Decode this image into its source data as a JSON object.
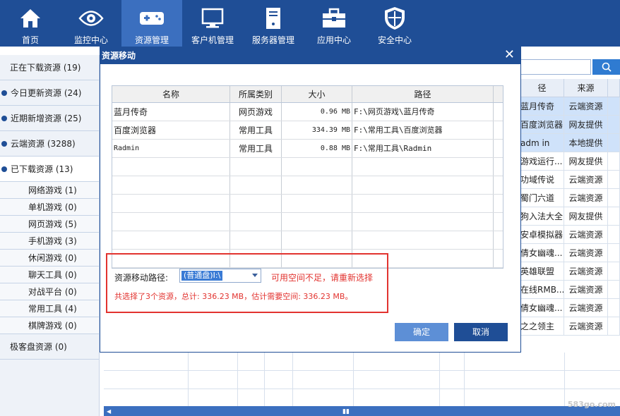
{
  "nav": {
    "items": [
      {
        "label": "首页",
        "icon": "home-icon"
      },
      {
        "label": "监控中心",
        "icon": "eye-icon"
      },
      {
        "label": "资源管理",
        "icon": "gamepad-icon"
      },
      {
        "label": "客户机管理",
        "icon": "monitor-icon"
      },
      {
        "label": "服务器管理",
        "icon": "server-icon"
      },
      {
        "label": "应用中心",
        "icon": "toolbox-icon"
      },
      {
        "label": "安全中心",
        "icon": "shield-icon"
      }
    ],
    "active_index": 2
  },
  "sidebar": {
    "top_items": [
      {
        "label": "正在下载资源 (19)"
      },
      {
        "label": "今日更新资源 (24)"
      },
      {
        "label": "近期新增资源 (25)"
      },
      {
        "label": "云端资源 (3288)"
      },
      {
        "label": "已下载资源 (13)"
      }
    ],
    "sub_items": [
      {
        "label": "网络游戏 (1)"
      },
      {
        "label": "单机游戏 (0)"
      },
      {
        "label": "网页游戏 (5)"
      },
      {
        "label": "手机游戏 (3)"
      },
      {
        "label": "休闲游戏 (0)"
      },
      {
        "label": "聊天工具 (0)"
      },
      {
        "label": "对战平台 (0)"
      },
      {
        "label": "常用工具 (4)"
      },
      {
        "label": "棋牌游戏 (0)"
      }
    ],
    "bottom_item": {
      "label": "极客盘资源 (0)"
    }
  },
  "background_table": {
    "headers": [
      "径",
      "来源"
    ],
    "rows": [
      {
        "path": "蓝月传奇",
        "source": "云端资源",
        "highlight": true
      },
      {
        "path": "百度浏览器",
        "source": "网友提供",
        "highlight": true
      },
      {
        "path": "adm in",
        "source": "本地提供",
        "highlight": true
      },
      {
        "path": "游戏运行...",
        "source": "网友提供",
        "highlight": false
      },
      {
        "path": "功域传说",
        "source": "云端资源",
        "highlight": false
      },
      {
        "path": "蜀门六道",
        "source": "云端资源",
        "highlight": false
      },
      {
        "path": "狗入法大全",
        "source": "网友提供",
        "highlight": false
      },
      {
        "path": "安卓模拟器",
        "source": "云端资源",
        "highlight": false
      },
      {
        "path": "倩女幽魂...",
        "source": "云端资源",
        "highlight": false
      },
      {
        "path": "英雄联盟",
        "source": "云端资源",
        "highlight": false
      },
      {
        "path": "在线RMB...",
        "source": "云端资源",
        "highlight": false
      },
      {
        "path": "倩女幽魂...",
        "source": "云端资源",
        "highlight": false
      },
      {
        "path": "之之领主",
        "source": "云端资源",
        "highlight": false
      }
    ],
    "watermark": "583go.com"
  },
  "dialog": {
    "title": "资源移动",
    "table": {
      "headers": [
        "名称",
        "所属类别",
        "大小",
        "路径"
      ],
      "rows": [
        {
          "name": "蓝月传奇",
          "category": "网页游戏",
          "size": "0.96 MB",
          "path": "F:\\网页游戏\\蓝月传奇"
        },
        {
          "name": "百度浏览器",
          "category": "常用工具",
          "size": "334.39 MB",
          "path": "F:\\常用工具\\百度浏览器"
        },
        {
          "name": "Radmin",
          "category": "常用工具",
          "size": "0.88 MB",
          "path": "F:\\常用工具\\Radmin"
        }
      ],
      "empty_rows": 6
    },
    "path_label": "资源移动路径:",
    "path_value": "(普通盘)I:\\",
    "warning": "可用空间不足，请重新选择",
    "summary": "共选择了3个资源，总计: 336.23 MB，估计需要空间: 336.23 MB。",
    "ok_label": "确定",
    "cancel_label": "取消"
  },
  "colors": {
    "nav_bg": "#1f4e96",
    "nav_active": "#3b6fbf",
    "warning_red": "#e2332f",
    "highlight_row": "#cfe2fa"
  }
}
